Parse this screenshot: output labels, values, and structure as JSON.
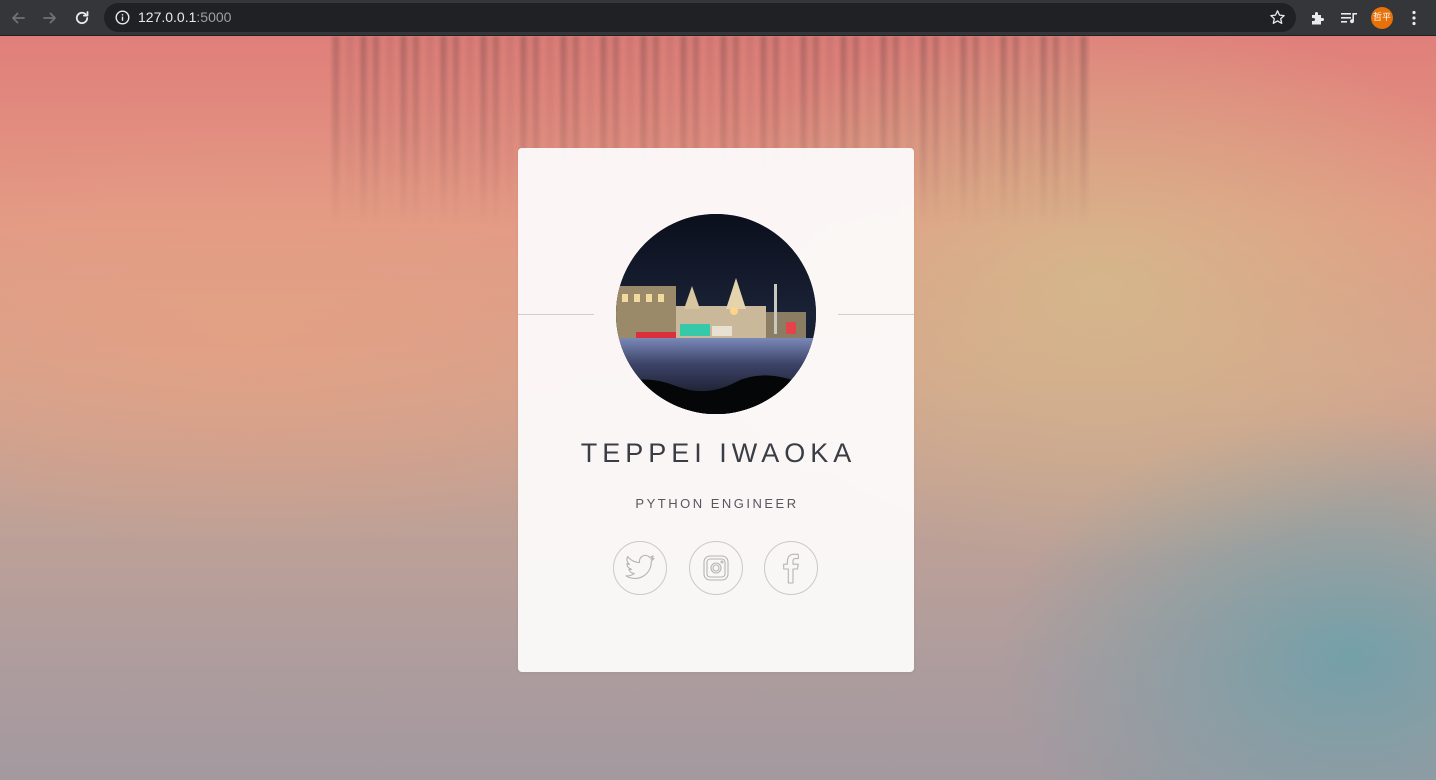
{
  "browser": {
    "url_host": "127.0.0.1",
    "url_port": ":5000",
    "profile_initials": "哲平",
    "icons": {
      "back": "back-arrow-icon",
      "forward": "forward-arrow-icon",
      "reload": "reload-icon",
      "site_info": "info-icon",
      "bookmark": "star-icon",
      "extensions": "puzzle-icon",
      "media": "media-queue-icon",
      "menu": "kebab-menu-icon"
    }
  },
  "profile": {
    "name": "TEPPEI IWAOKA",
    "role": "PYTHON ENGINEER",
    "social": [
      {
        "network": "twitter",
        "icon": "twitter-icon"
      },
      {
        "network": "instagram",
        "icon": "instagram-icon"
      },
      {
        "network": "facebook",
        "icon": "facebook-icon"
      }
    ]
  },
  "colors": {
    "card_bg": "#fcfafa",
    "text_dark": "#3a3d44",
    "avatar_badge": "#e8710a",
    "chrome_bg": "#35363a"
  }
}
